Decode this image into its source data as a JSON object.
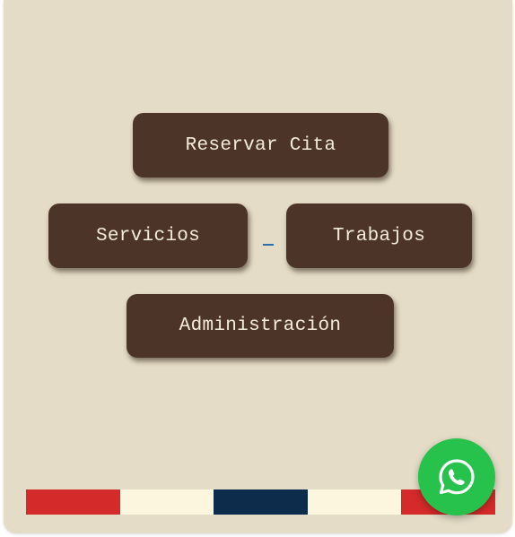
{
  "buttons": {
    "reservar": "Reservar Cita",
    "servicios": "Servicios",
    "trabajos": "Trabajos",
    "admin": "Administración"
  },
  "separator": "_",
  "whatsapp": {
    "icon": "whatsapp-icon",
    "color": "#27c24c"
  },
  "flag_stripes": [
    "#d42a2a",
    "#fdf6de",
    "#0d2b4a",
    "#fdf6de",
    "#d42a2a"
  ],
  "colors": {
    "background": "#e4dcc6",
    "button": "#4d3428",
    "button_text": "#f3ecdc"
  }
}
